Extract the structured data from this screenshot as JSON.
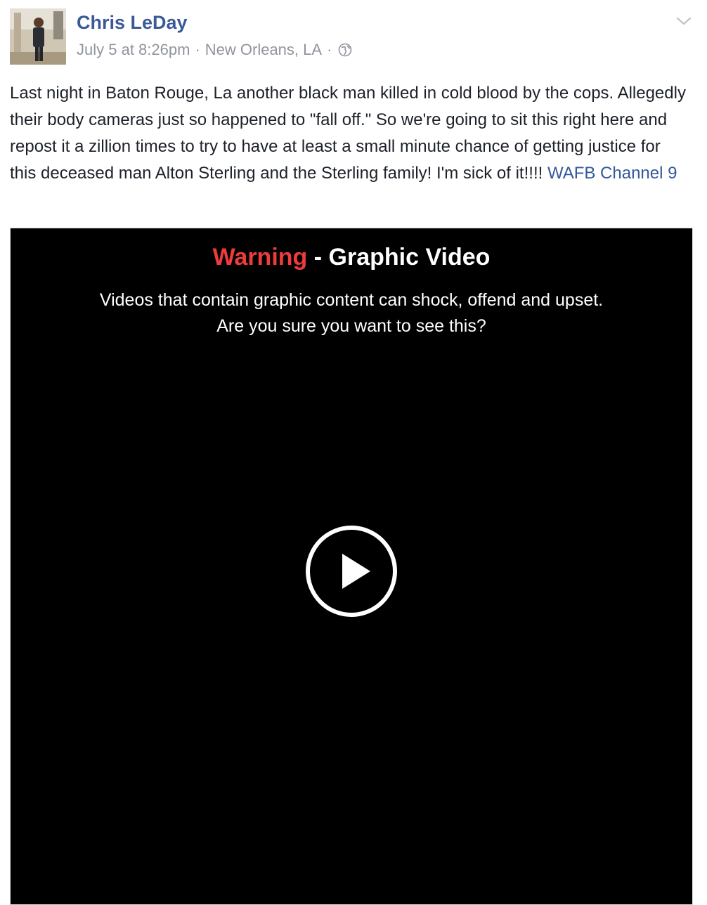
{
  "post": {
    "author": "Chris LeDay",
    "date": "July 5 at 8:26pm",
    "separator": "·",
    "location": "New Orleans, LA",
    "privacy_icon": "globe-icon",
    "menu_icon": "chevron-down-icon",
    "text": "Last night in Baton Rouge, La another black man killed in cold blood by the cops. Allegedly their body cameras just so happened to \"fall off.\" So we're going to sit this right here and repost it a zillion times to try to have at least a small minute chance of getting justice for this deceased man Alton Sterling and the Sterling family! I'm sick of it!!!! ",
    "tag": "WAFB Channel 9"
  },
  "video": {
    "warning_word": "Warning",
    "warning_rest": " - Graphic Video",
    "description_line1": "Videos that contain graphic content can shock, offend and upset.",
    "description_line2": "Are you sure you want to see this?",
    "play_icon": "play-icon"
  },
  "colors": {
    "author_link": "#3b5998",
    "meta_gray": "#90949c",
    "warning_red": "#ee3b3b",
    "video_bg": "#000000"
  }
}
